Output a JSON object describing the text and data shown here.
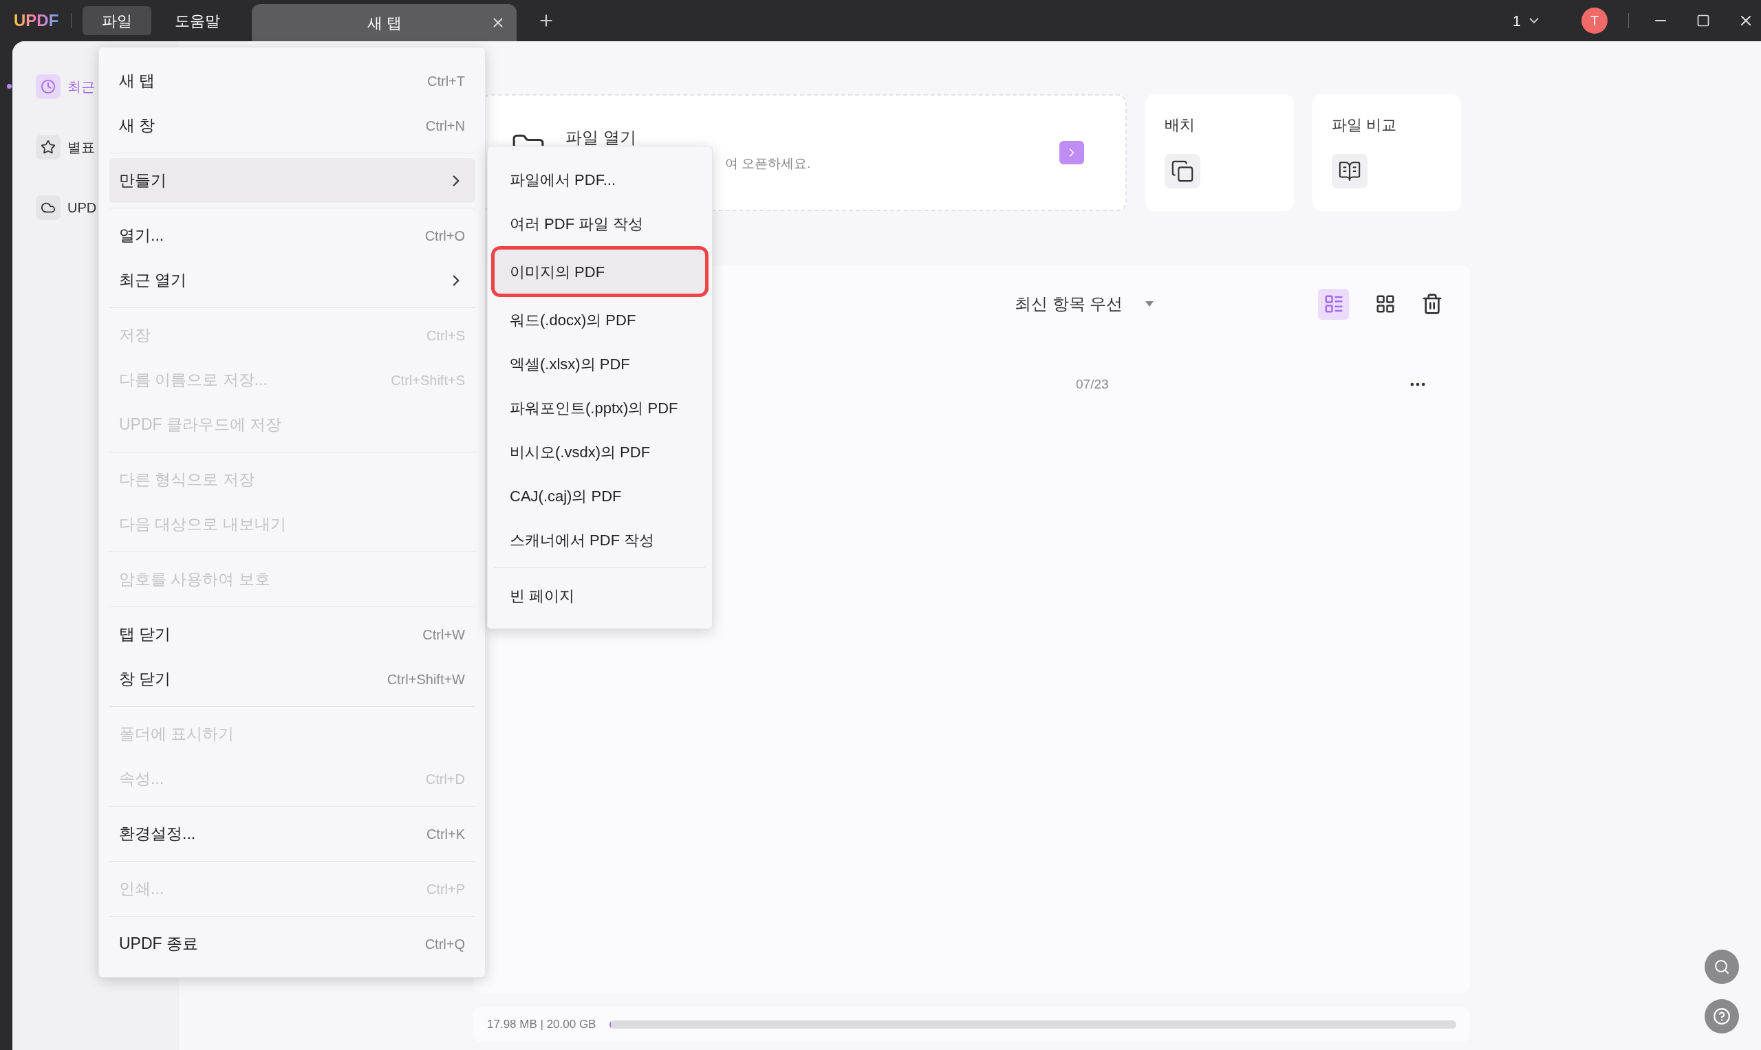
{
  "app": {
    "logo": "UPDF"
  },
  "menubar": [
    {
      "label": "파일",
      "selected": true
    },
    {
      "label": "도움말",
      "selected": false
    }
  ],
  "tabs": [
    {
      "label": "새 탭",
      "selected": true
    }
  ],
  "account": {
    "count": "1",
    "avatar": "T"
  },
  "sidebar": {
    "items": [
      {
        "label": "최근",
        "selected": true,
        "kind": "recent"
      },
      {
        "label": "별표",
        "selected": false,
        "kind": "starred"
      },
      {
        "label": "UPD",
        "selected": false,
        "kind": "cloud"
      }
    ]
  },
  "open_card": {
    "title": "파일 열기",
    "subtitle": "여 오픈하세요."
  },
  "tools": [
    {
      "title": "배치",
      "kind": "batch"
    },
    {
      "title": "파일 비교",
      "kind": "compare"
    }
  ],
  "recent": {
    "sort": "최신 항목 우선",
    "views": [
      {
        "kind": "list",
        "selected": true
      },
      {
        "kind": "grid",
        "selected": false
      }
    ],
    "rows": [
      {
        "date": "07/23"
      }
    ]
  },
  "storage": {
    "text": "17.98 MB | 20.00 GB",
    "level": 0.001
  },
  "file_menu": {
    "items": [
      {
        "kind": "item",
        "label": "새 탭",
        "shortcut": "Ctrl+T",
        "disabled": false,
        "highlighted": false,
        "submenu": false
      },
      {
        "kind": "item",
        "label": "새 창",
        "shortcut": "Ctrl+N",
        "disabled": false,
        "highlighted": false,
        "submenu": false
      },
      {
        "kind": "separator"
      },
      {
        "kind": "item",
        "label": "만들기",
        "disabled": false,
        "highlighted": true,
        "submenu": true
      },
      {
        "kind": "separator"
      },
      {
        "kind": "item",
        "label": "열기...",
        "shortcut": "Ctrl+O",
        "disabled": false,
        "highlighted": false,
        "submenu": false
      },
      {
        "kind": "item",
        "label": "최근 열기",
        "disabled": false,
        "highlighted": false,
        "submenu": true
      },
      {
        "kind": "separator"
      },
      {
        "kind": "item",
        "label": "저장",
        "shortcut": "Ctrl+S",
        "disabled": true,
        "highlighted": false,
        "submenu": false
      },
      {
        "kind": "item",
        "label": "다름 이름으로 저장...",
        "shortcut": "Ctrl+Shift+S",
        "disabled": true,
        "highlighted": false,
        "submenu": false
      },
      {
        "kind": "item",
        "label": "UPDF 클라우드에 저장",
        "disabled": true,
        "highlighted": false,
        "submenu": false
      },
      {
        "kind": "separator"
      },
      {
        "kind": "item",
        "label": "다른 형식으로 저장",
        "disabled": true,
        "highlighted": false,
        "submenu": false
      },
      {
        "kind": "item",
        "label": "다음 대상으로 내보내기",
        "disabled": true,
        "highlighted": false,
        "submenu": false
      },
      {
        "kind": "separator"
      },
      {
        "kind": "item",
        "label": "암호를 사용하여 보호",
        "disabled": true,
        "highlighted": false,
        "submenu": false
      },
      {
        "kind": "separator"
      },
      {
        "kind": "item",
        "label": "탭 닫기",
        "shortcut": "Ctrl+W",
        "disabled": false,
        "highlighted": false,
        "submenu": false
      },
      {
        "kind": "item",
        "label": "창 닫기",
        "shortcut": "Ctrl+Shift+W",
        "disabled": false,
        "highlighted": false,
        "submenu": false
      },
      {
        "kind": "separator"
      },
      {
        "kind": "item",
        "label": "폴더에 표시하기",
        "disabled": true,
        "highlighted": false,
        "submenu": false
      },
      {
        "kind": "item",
        "label": "속성...",
        "shortcut": "Ctrl+D",
        "disabled": true,
        "highlighted": false,
        "submenu": false
      },
      {
        "kind": "separator"
      },
      {
        "kind": "item",
        "label": "환경설정...",
        "shortcut": "Ctrl+K",
        "disabled": false,
        "highlighted": false,
        "submenu": false
      },
      {
        "kind": "separator"
      },
      {
        "kind": "item",
        "label": "인쇄...",
        "shortcut": "Ctrl+P",
        "disabled": true,
        "highlighted": false,
        "submenu": false
      },
      {
        "kind": "separator"
      },
      {
        "kind": "item",
        "label": "UPDF 종료",
        "shortcut": "Ctrl+Q",
        "disabled": false,
        "highlighted": false,
        "submenu": false
      }
    ]
  },
  "create_submenu": {
    "items": [
      {
        "kind": "item",
        "label": "파일에서 PDF...",
        "highlighted": false
      },
      {
        "kind": "item",
        "label": "여러 PDF 파일 작성",
        "highlighted": false
      },
      {
        "kind": "item",
        "label": "이미지의 PDF",
        "highlighted": true
      },
      {
        "kind": "item",
        "label": "워드(.docx)의 PDF",
        "highlighted": false
      },
      {
        "kind": "item",
        "label": "엑셀(.xlsx)의 PDF",
        "highlighted": false
      },
      {
        "kind": "item",
        "label": "파워포인트(.pptx)의 PDF",
        "highlighted": false
      },
      {
        "kind": "item",
        "label": "비시오(.vsdx)의 PDF",
        "highlighted": false
      },
      {
        "kind": "item",
        "label": "CAJ(.caj)의 PDF",
        "highlighted": false
      },
      {
        "kind": "item",
        "label": "스캐너에서 PDF 작성",
        "highlighted": false
      },
      {
        "kind": "separator"
      },
      {
        "kind": "item",
        "label": "빈 페이지",
        "highlighted": false
      }
    ]
  }
}
